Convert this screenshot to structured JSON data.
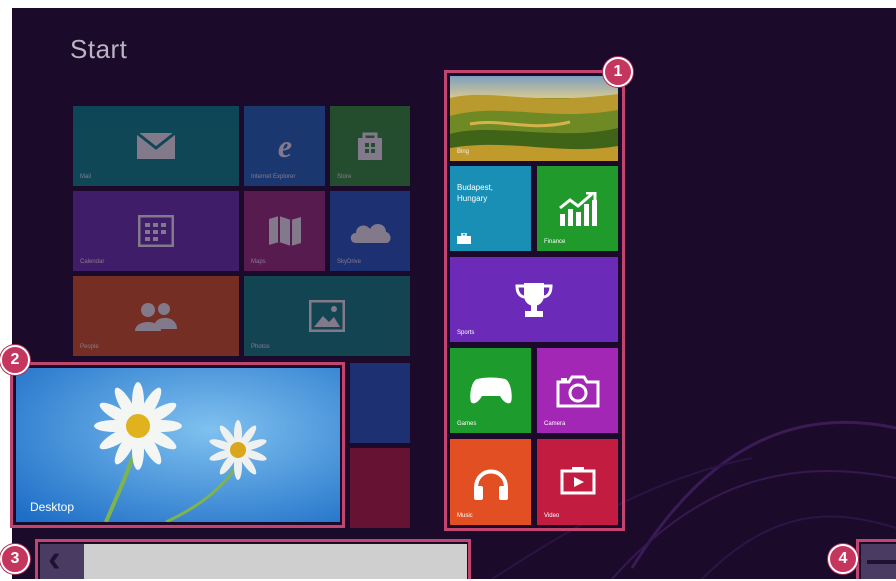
{
  "screen_title": "Start",
  "dim_tiles": {
    "mail": "Mail",
    "ie": "Internet Explorer",
    "store": "Store",
    "calendar": "Calendar",
    "maps": "Maps",
    "skydrive": "SkyDrive",
    "people": "People",
    "photos": "Photos"
  },
  "highlight_group": {
    "bing_label": "Bing",
    "travel_line1": "Budapest,",
    "travel_line2": "Hungary",
    "finance": "Finance",
    "sports": "Sports",
    "games": "Games",
    "camera": "Camera",
    "music": "Music",
    "video": "Video"
  },
  "desktop_tile": {
    "label": "Desktop"
  },
  "badges": {
    "b1": "1",
    "b2": "2",
    "b3": "3",
    "b4": "4"
  },
  "scrollbar": {
    "left_arrow": "‹"
  },
  "colors": {
    "background": "#1c0a2b",
    "highlight": "#c0456f",
    "travel": "#1a8fb6",
    "finance": "#1f9a2b",
    "sports": "#6b2bb8",
    "games": "#1d9b2d",
    "camera": "#a327b5",
    "music": "#e24f22",
    "video": "#c31c41"
  },
  "icons": [
    "mail-icon",
    "internet-explorer-icon",
    "store-icon",
    "calendar-icon",
    "maps-icon",
    "skydrive-icon",
    "people-icon",
    "photos-icon",
    "finance-icon",
    "sports-trophy-icon",
    "games-controller-icon",
    "camera-icon",
    "music-headphones-icon",
    "video-play-icon",
    "suitcase-icon"
  ]
}
